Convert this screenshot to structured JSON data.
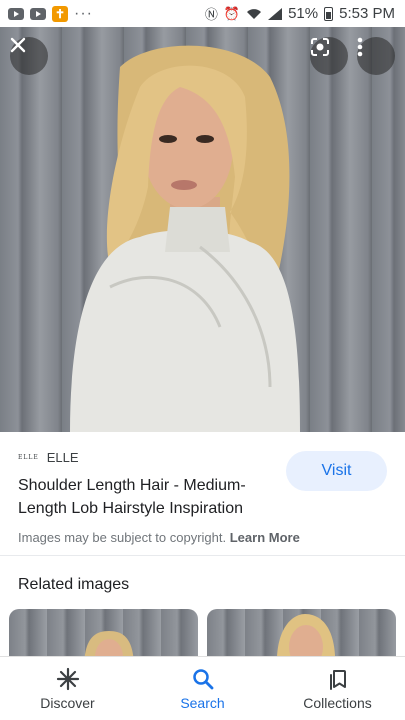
{
  "status_bar": {
    "more_dots": "···",
    "battery": "51%",
    "time": "5:53 PM"
  },
  "result": {
    "source_logo": "ELLE",
    "source_name": "ELLE",
    "title": "Shoulder Length Hair - Medium-Length Lob Hairstyle Inspiration",
    "visit_label": "Visit",
    "copyright_text": "Images may be subject to copyright.",
    "learn_more_label": "Learn More"
  },
  "related": {
    "heading": "Related images"
  },
  "bottom_nav": {
    "discover": "Discover",
    "search": "Search",
    "collections": "Collections"
  },
  "colors": {
    "accent": "#1a73e8",
    "visit_bg": "#e8f0fe",
    "text_primary": "#202124",
    "text_secondary": "#70757a"
  }
}
